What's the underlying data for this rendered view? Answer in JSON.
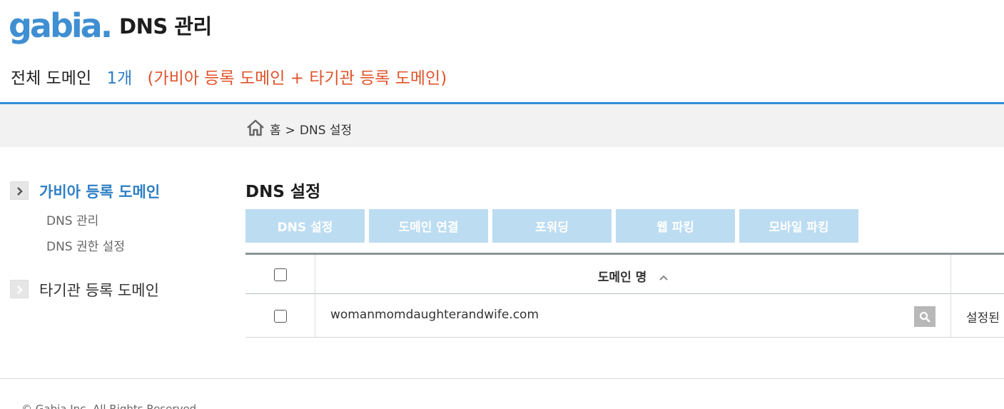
{
  "header": {
    "logo_text": "gabia.",
    "title": "DNS 관리"
  },
  "summary": {
    "label": "전체 도메인",
    "count": "1개",
    "note": "(가비아 등록 도메인 + 타기관 등록 도메인)"
  },
  "breadcrumb": {
    "home": "홈",
    "separator": ">",
    "current": "DNS 설정"
  },
  "sidebar": {
    "groups": [
      {
        "label": "가비아 등록 도메인",
        "active": true,
        "items": [
          "DNS 관리",
          "DNS 권한 설정"
        ]
      },
      {
        "label": "타기관 등록 도메인",
        "active": false,
        "items": []
      }
    ]
  },
  "main": {
    "title": "DNS 설정",
    "tabs": [
      "DNS 설정",
      "도메인 연결",
      "포워딩",
      "웹 파킹",
      "모바일 파킹"
    ],
    "table": {
      "header_domain": "도메인 명",
      "rows": [
        {
          "domain": "womanmomdaughterandwife.com",
          "status": "설정된"
        }
      ]
    }
  },
  "footer": {
    "text": "© Gabia Inc. All Rights Reserved."
  },
  "colors": {
    "accent_blue": "#2f8fd8",
    "count_blue": "#2f7fc5",
    "note_orange": "#e0542b",
    "tab_bg": "#bcdcf1"
  }
}
